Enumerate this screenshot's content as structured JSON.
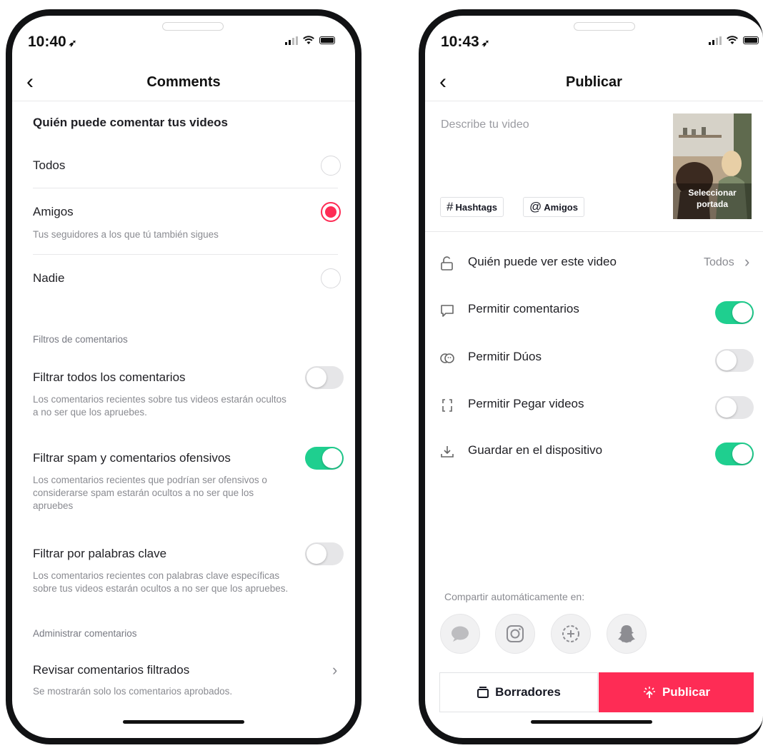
{
  "left": {
    "status_time": "10:40",
    "title": "Comments",
    "section_who": "Quién puede comentar tus videos",
    "options": [
      {
        "label": "Todos",
        "selected": false
      },
      {
        "label": "Amigos",
        "selected": true,
        "sub": "Tus seguidores a los que tú también sigues"
      },
      {
        "label": "Nadie",
        "selected": false
      }
    ],
    "filters_header": "Filtros de comentarios",
    "filters": [
      {
        "label": "Filtrar todos los comentarios",
        "on": false,
        "desc_line1": "Los comentarios recientes sobre tus videos estarán ocultos",
        "desc_line2": "a no ser que los apruebes."
      },
      {
        "label": "Filtrar spam y comentarios ofensivos",
        "on": true,
        "desc_line1": "Los comentarios recientes que podrían ser ofensivos o",
        "desc_line2": "considerarse spam estarán ocultos a no ser que los",
        "desc_line3": "apruebes"
      },
      {
        "label": "Filtrar por palabras clave",
        "on": false,
        "desc_line1": "Los comentarios recientes con palabras clave específicas",
        "desc_line2": "sobre tus videos estarán ocultos a no ser que los apruebes."
      }
    ],
    "manage_header": "Administrar comentarios",
    "review_label": "Revisar comentarios filtrados",
    "review_desc": "Se mostrarán solo los comentarios aprobados."
  },
  "right": {
    "status_time": "10:43",
    "title": "Publicar",
    "describe_placeholder": "Describe tu video",
    "chip_hashtags": "Hashtags",
    "chip_amigos": "Amigos",
    "cover_label_1": "Seleccionar",
    "cover_label_2": "portada",
    "who_label": "Quién puede ver este video",
    "who_value": "Todos",
    "settings": [
      {
        "label": "Permitir comentarios",
        "icon": "comment-icon",
        "on": true
      },
      {
        "label": "Permitir Dúos",
        "icon": "duet-icon",
        "on": false
      },
      {
        "label": "Permitir Pegar videos",
        "icon": "stitch-icon",
        "on": false
      },
      {
        "label": "Guardar en el dispositivo",
        "icon": "download-icon",
        "on": true
      }
    ],
    "share_label": "Compartir automáticamente en:",
    "share_icons": [
      "message-icon",
      "instagram-icon",
      "stories-add-icon",
      "snapchat-icon"
    ],
    "drafts_label": "Borradores",
    "publish_label": "Publicar"
  },
  "colors": {
    "accent_red": "#fe2c55",
    "toggle_green": "#1fcf8f"
  }
}
